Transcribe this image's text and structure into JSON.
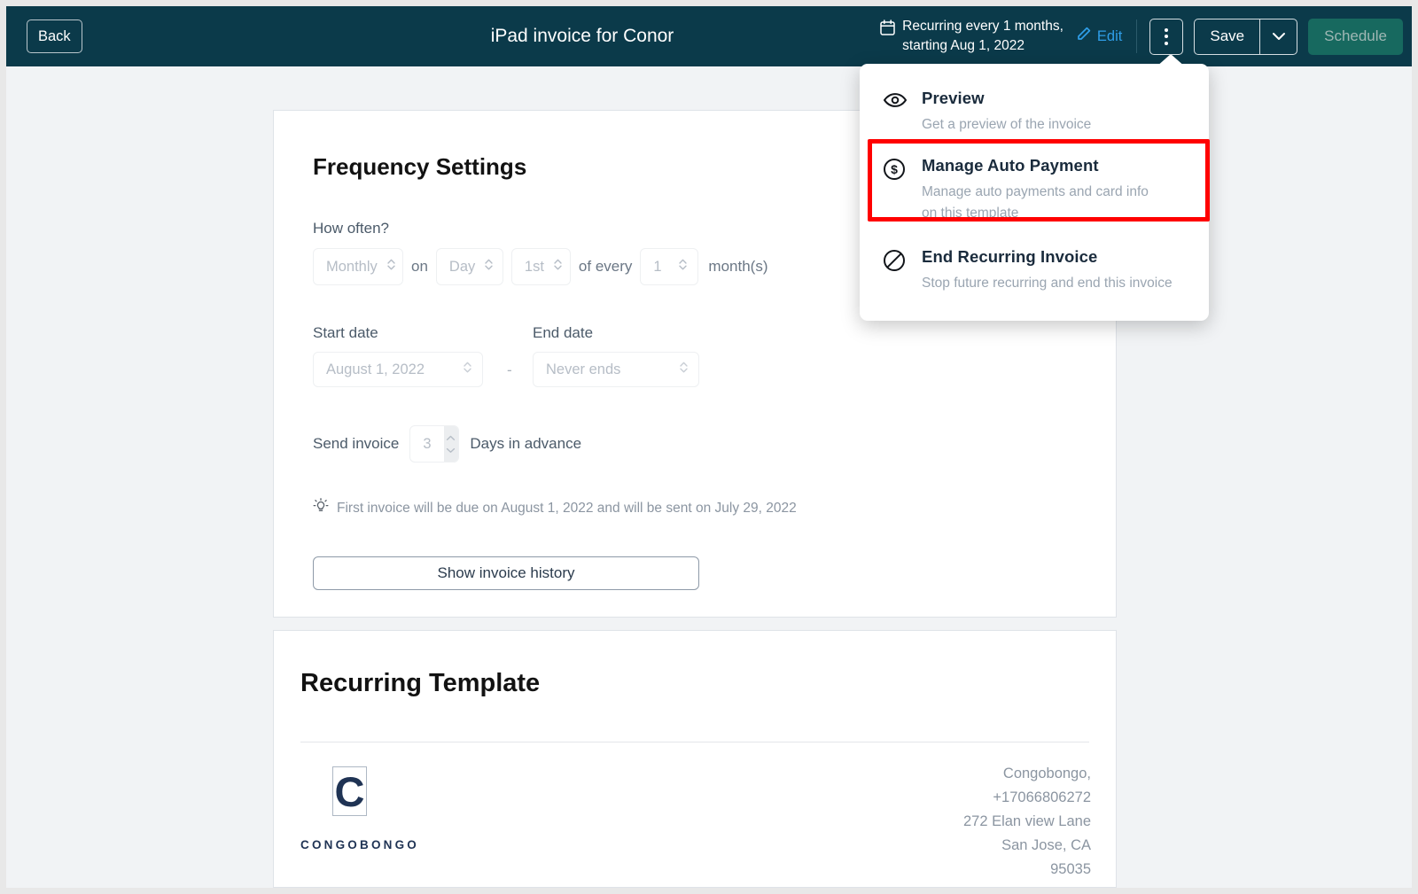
{
  "topbar": {
    "back_label": "Back",
    "title": "iPad invoice for Conor",
    "calendar_icon": "calendar-icon",
    "recurring_line1": "Recurring every 1 months,",
    "recurring_line2": "starting Aug 1, 2022",
    "edit_label": "Edit",
    "pencil_icon": "pencil-icon",
    "kebab_icon": "kebab-menu-icon",
    "save_label": "Save",
    "save_caret_icon": "chevron-down-icon",
    "schedule_label": "Schedule",
    "bg_color": "#0b3a4a",
    "edit_link_color": "#2f9ee8",
    "schedule_bg": "#17695f",
    "schedule_text_color": "#9fb7b4"
  },
  "menu": {
    "items": [
      {
        "icon": "eye-icon",
        "title": "Preview",
        "subtitle": "Get a preview of the invoice",
        "highlighted": false
      },
      {
        "icon": "dollar-circle-icon",
        "title": "Manage Auto Payment",
        "subtitle": "Manage auto payments and card info on this template",
        "highlighted": true
      },
      {
        "icon": "no-entry-icon",
        "title": "End Recurring Invoice",
        "subtitle": "Stop future recurring and end this invoice",
        "highlighted": false
      }
    ],
    "highlight_color": "#ff0000"
  },
  "frequency_card": {
    "heading": "Frequency Settings",
    "how_often_label": "How often?",
    "interval_select": {
      "value": "Monthly",
      "icon": "updown-chevron-icon"
    },
    "on_label": "on",
    "daytype_select": {
      "value": "Day",
      "icon": "updown-chevron-icon"
    },
    "dayordinal_select": {
      "value": "1st",
      "icon": "updown-chevron-icon"
    },
    "of_every_label": "of every",
    "count_select": {
      "value": "1",
      "icon": "updown-chevron-icon"
    },
    "months_label": "month(s)",
    "start_date_label": "Start date",
    "start_date_value": "August 1, 2022",
    "date_separator": "-",
    "end_date_label": "End date",
    "end_date_value": "Never ends",
    "send_invoice_label": "Send invoice",
    "send_invoice_days": "3",
    "days_in_advance_label": "Days in advance",
    "hint_icon": "lightbulb-icon",
    "hint_text": "First invoice will be due on August 1, 2022 and will be sent on July 29, 2022",
    "history_button_label": "Show invoice history"
  },
  "template_card": {
    "heading": "Recurring Template",
    "logo_letter": "C",
    "logo_wordmark": "CONGOBONGO",
    "business": {
      "name": "Congobongo,",
      "phone": "+17066806272",
      "street": "272 Elan view Lane",
      "city_state": "San Jose, CA",
      "zip": "95035"
    }
  }
}
